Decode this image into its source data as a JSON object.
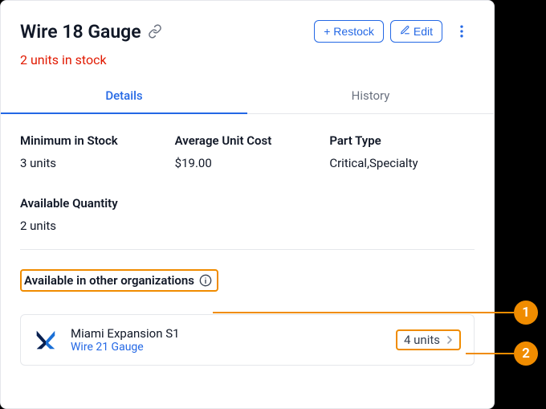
{
  "header": {
    "title": "Wire 18 Gauge",
    "restock_label": "+ Restock",
    "edit_label": "Edit"
  },
  "stock": {
    "text": "2 units in stock"
  },
  "tabs": {
    "details": "Details",
    "history": "History"
  },
  "fields": {
    "min_stock_label": "Minimum in Stock",
    "min_stock_value": "3 units",
    "avg_cost_label": "Average Unit Cost",
    "avg_cost_value": "$19.00",
    "part_type_label": "Part Type",
    "part_type_value": "Critical,Specialty",
    "avail_qty_label": "Available Quantity",
    "avail_qty_value": "2 units"
  },
  "other_orgs": {
    "heading": "Available in other organizations",
    "items": [
      {
        "name": "Miami Expansion S1",
        "part": "Wire 21 Gauge",
        "units": "4 units"
      }
    ]
  },
  "callouts": {
    "c1": "1",
    "c2": "2"
  },
  "colors": {
    "accent": "#2468e5",
    "warn": "#f08c00",
    "danger": "#e11900"
  }
}
